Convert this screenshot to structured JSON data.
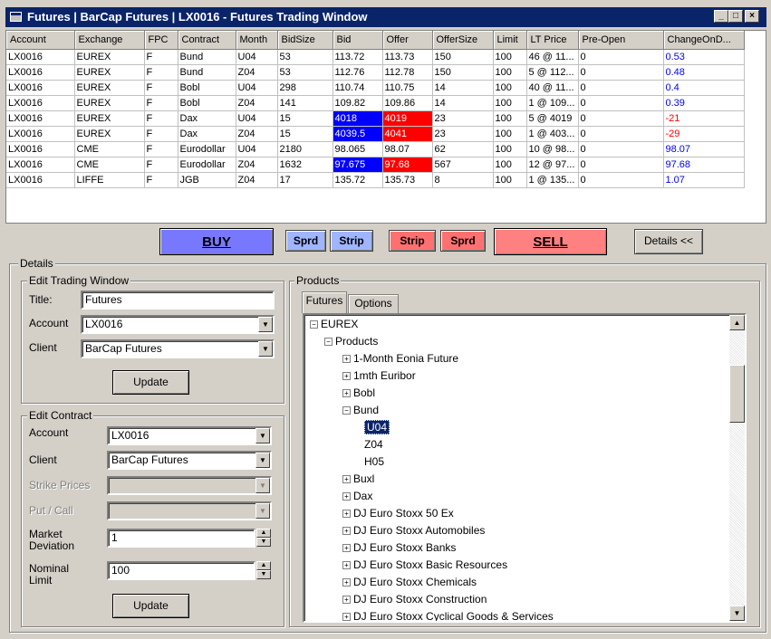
{
  "window": {
    "title": "Futures | BarCap Futures | LX0016 - Futures Trading Window",
    "min": "_",
    "max": "□",
    "close": "×"
  },
  "grid": {
    "columns": [
      "Account",
      "Exchange",
      "FPC",
      "Contract",
      "Month",
      "BidSize",
      "Bid",
      "Offer",
      "OfferSize",
      "Limit",
      "LT Price",
      "Pre-Open",
      "ChangeOnD..."
    ],
    "rows": [
      [
        "LX0016",
        "EUREX",
        "F",
        "Bund",
        "U04",
        "53",
        "113.72",
        "113.73",
        "150",
        "100",
        "46 @ 11...",
        "0",
        "0.53"
      ],
      [
        "LX0016",
        "EUREX",
        "F",
        "Bund",
        "Z04",
        "53",
        "112.76",
        "112.78",
        "150",
        "100",
        "5 @ 112...",
        "0",
        "0.48"
      ],
      [
        "LX0016",
        "EUREX",
        "F",
        "Bobl",
        "U04",
        "298",
        "110.74",
        "110.75",
        "14",
        "100",
        "40 @ 11...",
        "0",
        "0.4"
      ],
      [
        "LX0016",
        "EUREX",
        "F",
        "Bobl",
        "Z04",
        "141",
        "109.82",
        "109.86",
        "14",
        "100",
        "1 @ 109...",
        "0",
        "0.39"
      ],
      [
        "LX0016",
        "EUREX",
        "F",
        "Dax",
        "U04",
        "15",
        "4018",
        "4019",
        "23",
        "100",
        "5 @ 4019",
        "0",
        "-21"
      ],
      [
        "LX0016",
        "EUREX",
        "F",
        "Dax",
        "Z04",
        "15",
        "4039.5",
        "4041",
        "23",
        "100",
        "1 @ 403...",
        "0",
        "-29"
      ],
      [
        "LX0016",
        "CME",
        "F",
        "Eurodollar",
        "U04",
        "2180",
        "98.065",
        "98.07",
        "62",
        "100",
        "10 @ 98...",
        "0",
        "98.07"
      ],
      [
        "LX0016",
        "CME",
        "F",
        "Eurodollar",
        "Z04",
        "1632",
        "97.675",
        "97.68",
        "567",
        "100",
        "12 @ 97...",
        "0",
        "97.68"
      ],
      [
        "LX0016",
        "LIFFE",
        "F",
        "JGB",
        "Z04",
        "17",
        "135.72",
        "135.73",
        "8",
        "100",
        "1 @ 135...",
        "0",
        "1.07"
      ]
    ],
    "highlighted_rows": [
      4,
      5,
      7
    ],
    "colors": {
      "positive": "#0000ff",
      "negative": "#ff0000",
      "bid_highlight": "#0000ff",
      "offer_highlight": "#ff0000"
    }
  },
  "tradebar": {
    "buy": "BUY",
    "buy_sprd": "Sprd",
    "buy_strip": "Strip",
    "sell_strip": "Strip",
    "sell_sprd": "Sprd",
    "sell": "SELL",
    "details": "Details <<",
    "colors": {
      "buy": "#7878ff",
      "sell": "#ff8080",
      "buy_small": "#9fb5ff",
      "sell_small": "#ff7070"
    }
  },
  "details": {
    "label": "Details",
    "edit_window": {
      "label": "Edit Trading Window",
      "title_label": "Title:",
      "title_value": "Futures",
      "account_label": "Account",
      "account_value": "LX0016",
      "client_label": "Client",
      "client_value": "BarCap Futures",
      "update": "Update"
    },
    "edit_contract": {
      "label": "Edit Contract",
      "account_label": "Account",
      "account_value": "LX0016",
      "client_label": "Client",
      "client_value": "BarCap Futures",
      "strike_label": "Strike Prices",
      "putcall_label": "Put / Call",
      "deviation_label": "Market Deviation",
      "deviation_value": "1",
      "limit_label": "Nominal Limit",
      "limit_value": "100",
      "update": "Update"
    }
  },
  "products": {
    "label": "Products",
    "tabs": [
      "Futures",
      "Options"
    ],
    "tree": [
      {
        "text": "EUREX",
        "level": 0,
        "sign": "−"
      },
      {
        "text": "Products",
        "level": 1,
        "sign": "−"
      },
      {
        "text": "1-Month Eonia Future",
        "level": 2,
        "sign": "+"
      },
      {
        "text": "1mth Euribor",
        "level": 2,
        "sign": "+"
      },
      {
        "text": "Bobl",
        "level": 2,
        "sign": "+"
      },
      {
        "text": "Bund",
        "level": 2,
        "sign": "−"
      },
      {
        "text": "U04",
        "level": 3,
        "sign": ""
      },
      {
        "text": "Z04",
        "level": 3,
        "sign": ""
      },
      {
        "text": "H05",
        "level": 3,
        "sign": ""
      },
      {
        "text": "Buxl",
        "level": 2,
        "sign": "+"
      },
      {
        "text": "Dax",
        "level": 2,
        "sign": "+"
      },
      {
        "text": "DJ Euro Stoxx 50 Ex",
        "level": 2,
        "sign": "+"
      },
      {
        "text": "DJ Euro Stoxx Automobiles",
        "level": 2,
        "sign": "+"
      },
      {
        "text": "DJ Euro Stoxx Banks",
        "level": 2,
        "sign": "+"
      },
      {
        "text": "DJ Euro Stoxx Basic Resources",
        "level": 2,
        "sign": "+"
      },
      {
        "text": "DJ Euro Stoxx Chemicals",
        "level": 2,
        "sign": "+"
      },
      {
        "text": "DJ Euro Stoxx Construction",
        "level": 2,
        "sign": "+"
      },
      {
        "text": "DJ Euro Stoxx Cyclical Goods & Services",
        "level": 2,
        "sign": "+"
      }
    ],
    "selected": "U04"
  }
}
